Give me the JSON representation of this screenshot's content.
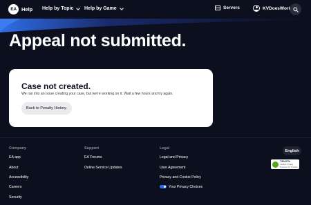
{
  "header": {
    "logo": "EA",
    "brand": "Help",
    "nav": [
      {
        "label": "Help by Topic"
      },
      {
        "label": "Help by Game"
      }
    ],
    "servers_label": "Servers",
    "user_label": "KVDoesWork"
  },
  "page": {
    "title": "Appeal not submitted."
  },
  "card": {
    "title": "Case not created.",
    "message": "We ran into an issue creating your case, but we're working on it. Wait a few hours and try again.",
    "button_label": "Back to Penalty History."
  },
  "footer": {
    "columns": [
      {
        "heading": "Company",
        "links": [
          "EA app",
          "About",
          "Accessibility",
          "Careers",
          "Security"
        ]
      },
      {
        "heading": "Support",
        "links": [
          "EA Forums",
          "Online Service Updates"
        ]
      },
      {
        "heading": "Legal",
        "links": [
          "Legal and Privacy",
          "User Agreement",
          "Privacy and Cookie Policy",
          "Your Privacy Choices"
        ]
      }
    ],
    "language": "English",
    "badge": {
      "title": "TRUSTe",
      "line1": "Verified Privacy",
      "line2": "Powered by TrustArc"
    }
  },
  "colors": {
    "background": "#0c0f1d",
    "card": "#ffffff",
    "accent_blue": "#2f6ee8"
  }
}
